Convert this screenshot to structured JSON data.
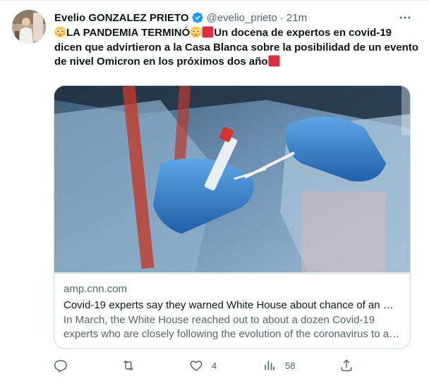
{
  "tweet": {
    "name": "Evelio GONZALEZ PRIETO",
    "handle": "@evelio_prieto",
    "separator": "·",
    "time": "21m",
    "text_part1": "LA PANDEMIA TERMINÓ",
    "text_part2": "Un docena de expertos en covid-19 dicen que advirtieron a la Casa Blanca sobre la posibilidad de un evento de nivel Omicron en los próximos dos año",
    "emojis": [
      "flushed-face",
      "red-square"
    ],
    "colors": {
      "verified": "#1d9bf0",
      "text": "#0f1419",
      "secondary": "#536471",
      "border": "#cfd9de",
      "emoji_red": "#e0245e"
    }
  },
  "card": {
    "image_icon": "covid-test-swab-photo",
    "domain": "amp.cnn.com",
    "title": "Covid-19 experts say they warned White House about chance of an Omicron-level event in next two years",
    "description": "In March, the White House reached out to about a dozen Covid-19 experts who are closely following the evolution of the coronavirus to ask what they expected in the next two years."
  },
  "actions": {
    "reply_count": "",
    "retweet_count": "",
    "like_count": "4",
    "views_count": "58",
    "icons": [
      "reply-icon",
      "retweet-icon",
      "like-icon",
      "views-icon",
      "share-icon"
    ]
  }
}
